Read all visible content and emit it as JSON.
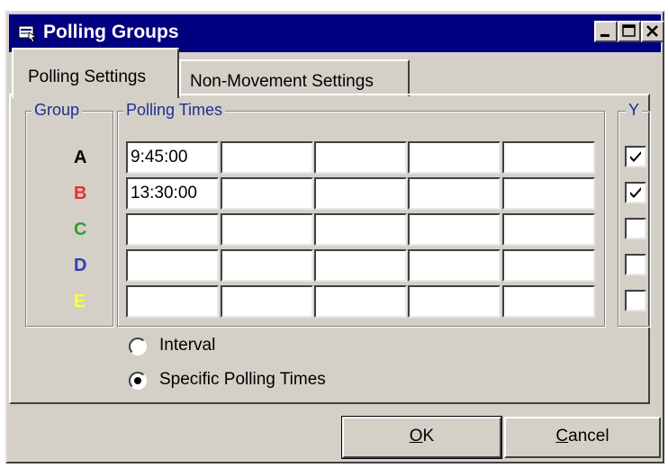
{
  "window": {
    "title": "Polling Groups"
  },
  "tabs": [
    {
      "label": "Polling Settings",
      "active": true
    },
    {
      "label": "Non-Movement Settings",
      "active": false
    }
  ],
  "group_box": {
    "legend": "Group",
    "items": [
      {
        "letter": "A",
        "color": "#000000"
      },
      {
        "letter": "B",
        "color": "#e8302c"
      },
      {
        "letter": "C",
        "color": "#2f9e2f"
      },
      {
        "letter": "D",
        "color": "#2f3fb0"
      },
      {
        "letter": "E",
        "color": "#ffff33"
      }
    ]
  },
  "times_box": {
    "legend": "Polling Times",
    "rows": [
      [
        "9:45:00",
        "",
        "",
        "",
        ""
      ],
      [
        "13:30:00",
        "",
        "",
        "",
        ""
      ],
      [
        "",
        "",
        "",
        "",
        ""
      ],
      [
        "",
        "",
        "",
        "",
        ""
      ],
      [
        "",
        "",
        "",
        "",
        ""
      ]
    ]
  },
  "y_box": {
    "legend": "Y",
    "checked": [
      true,
      true,
      false,
      false,
      false
    ]
  },
  "mode": {
    "options": [
      {
        "label": "Interval",
        "selected": false
      },
      {
        "label": "Specific Polling Times",
        "selected": true
      }
    ]
  },
  "buttons": {
    "ok_first": "O",
    "ok_rest": "K",
    "cancel_first": "C",
    "cancel_rest": "ancel"
  }
}
